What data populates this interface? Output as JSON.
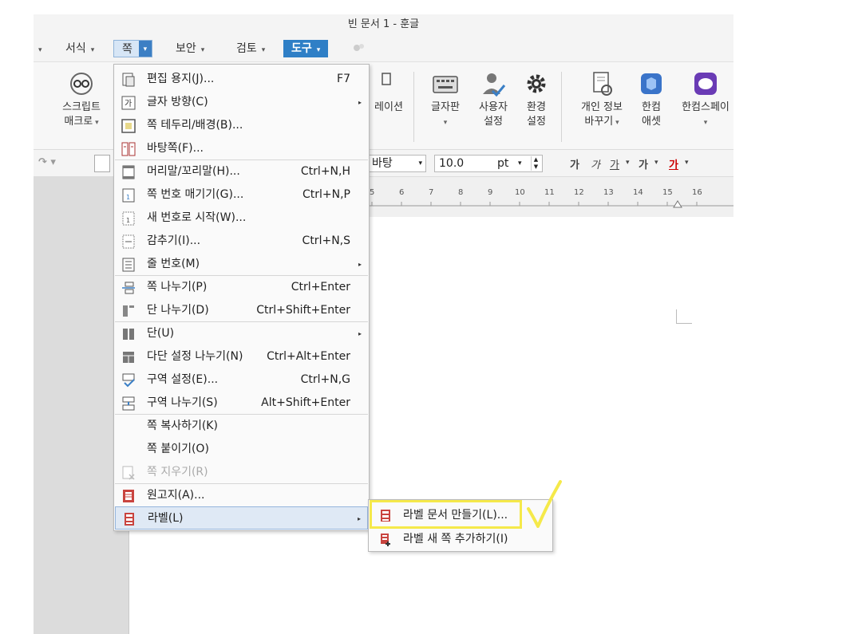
{
  "window": {
    "title": "빈 문서 1 - 훈글"
  },
  "menubar": {
    "items": [
      {
        "label": "서식"
      },
      {
        "label": "쪽"
      },
      {
        "label": "보안"
      },
      {
        "label": "검토"
      },
      {
        "label": "도구"
      }
    ]
  },
  "ribbon": {
    "script_macro": {
      "line1": "스크립트",
      "line2": "매크로"
    },
    "animation_label": "레이션",
    "keyboard": {
      "line1": "글자판"
    },
    "user_settings": {
      "line1": "사용자",
      "line2": "설정"
    },
    "env_settings": {
      "line1": "환경",
      "line2": "설정"
    },
    "privacy": {
      "line1": "개인 정보",
      "line2": "바꾸기"
    },
    "hancom_asset": {
      "line1": "한컴",
      "line2": "애셋"
    },
    "hancom_space": {
      "line1": "한컴스페이"
    }
  },
  "formatbar": {
    "font_value": "바탕",
    "size_value": "10.0",
    "unit_value": "pt",
    "bold": "가",
    "italic": "가",
    "underline": "가",
    "strike": "가",
    "color": "가"
  },
  "ruler": {
    "ticks": [
      "5",
      "6",
      "7",
      "8",
      "9",
      "10",
      "11",
      "12",
      "13",
      "14",
      "15",
      "16"
    ]
  },
  "page_menu": {
    "items": [
      {
        "label": "편집 용지(J)...",
        "shortcut": "F7"
      },
      {
        "label": "글자 방향(C)",
        "shortcut": ""
      },
      {
        "label": "쪽 테두리/배경(B)...",
        "shortcut": ""
      },
      {
        "label": "바탕쪽(F)...",
        "shortcut": ""
      },
      {
        "label": "머리말/꼬리말(H)...",
        "shortcut": "Ctrl+N,H"
      },
      {
        "label": "쪽 번호 매기기(G)...",
        "shortcut": "Ctrl+N,P"
      },
      {
        "label": "새 번호로 시작(W)...",
        "shortcut": ""
      },
      {
        "label": "감추기(I)...",
        "shortcut": "Ctrl+N,S"
      },
      {
        "label": "줄 번호(M)",
        "shortcut": ""
      },
      {
        "label": "쪽 나누기(P)",
        "shortcut": "Ctrl+Enter"
      },
      {
        "label": "단 나누기(D)",
        "shortcut": "Ctrl+Shift+Enter"
      },
      {
        "label": "단(U)",
        "shortcut": ""
      },
      {
        "label": "다단 설정 나누기(N)",
        "shortcut": "Ctrl+Alt+Enter"
      },
      {
        "label": "구역 설정(E)...",
        "shortcut": "Ctrl+N,G"
      },
      {
        "label": "구역 나누기(S)",
        "shortcut": "Alt+Shift+Enter"
      },
      {
        "label": "쪽 복사하기(K)",
        "shortcut": ""
      },
      {
        "label": "쪽 붙이기(O)",
        "shortcut": ""
      },
      {
        "label": "쪽 지우기(R)",
        "shortcut": ""
      },
      {
        "label": "원고지(A)...",
        "shortcut": ""
      },
      {
        "label": "라벨(L)",
        "shortcut": ""
      }
    ]
  },
  "label_submenu": {
    "items": [
      {
        "label": "라벨 문서 만들기(L)..."
      },
      {
        "label": "라벨 새 쪽 추가하기(I)"
      }
    ]
  },
  "colors": {
    "accent": "#2f7fc6",
    "highlight": "#f5e94a",
    "menu_active": "#dfe9f5"
  }
}
